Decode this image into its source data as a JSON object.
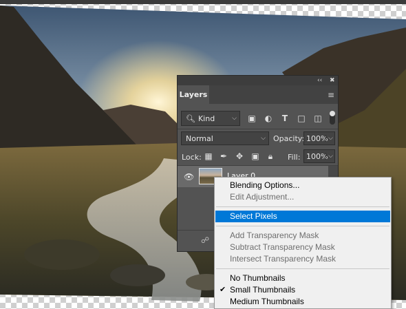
{
  "layers_panel": {
    "tab_label": "Layers",
    "topbar_collapse_glyph": "‹‹",
    "topbar_close_glyph": "✖",
    "panel_menu_glyph": "≡",
    "filter": {
      "label": "Kind",
      "icon": "search-icon"
    },
    "filter_icons": [
      "image-filter-icon",
      "adjustment-filter-icon",
      "type-filter-icon",
      "shape-filter-icon",
      "smart-object-filter-icon"
    ],
    "blend_mode": "Normal",
    "opacity_label": "Opacity:",
    "opacity_value": "100%",
    "lock_label": "Lock:",
    "fill_label": "Fill:",
    "fill_value": "100%",
    "layer": {
      "name": "Layer 0"
    }
  },
  "context_menu": {
    "items": [
      {
        "label": "Blending Options...",
        "enabled": true
      },
      {
        "label": "Edit Adjustment...",
        "enabled": false
      },
      {
        "label": "Select Pixels",
        "enabled": true,
        "highlighted": true
      },
      {
        "label": "Add Transparency Mask",
        "enabled": false
      },
      {
        "label": "Subtract Transparency Mask",
        "enabled": false
      },
      {
        "label": "Intersect Transparency Mask",
        "enabled": false
      },
      {
        "label": "No Thumbnails",
        "enabled": true
      },
      {
        "label": "Small Thumbnails",
        "enabled": true,
        "checked": true
      },
      {
        "label": "Medium Thumbnails",
        "enabled": true
      }
    ]
  },
  "colors": {
    "panel_bg": "#535353",
    "menu_highlight": "#0078d7",
    "menu_bg": "#f0f0f0"
  }
}
